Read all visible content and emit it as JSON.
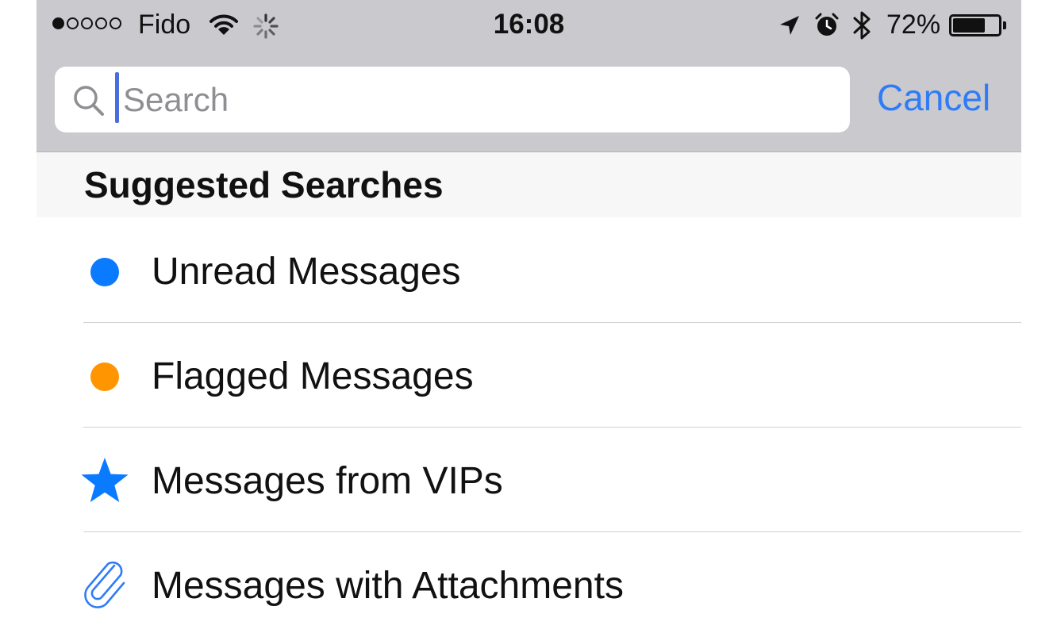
{
  "status_bar": {
    "carrier": "Fido",
    "time": "16:08",
    "battery_percent": "72%",
    "battery_level": 0.72,
    "signal_strength": 1,
    "signal_max": 5,
    "icons": [
      "wifi-icon",
      "activity-spinner-icon",
      "location-arrow-icon",
      "alarm-clock-icon",
      "bluetooth-icon",
      "battery-icon"
    ]
  },
  "search": {
    "placeholder": "Search",
    "value": "",
    "cancel_label": "Cancel",
    "icon": "search-icon"
  },
  "section": {
    "title": "Suggested Searches"
  },
  "suggestions": [
    {
      "label": "Unread Messages",
      "icon": "blue-dot-icon",
      "color": "#0a7aff"
    },
    {
      "label": "Flagged Messages",
      "icon": "orange-dot-icon",
      "color": "#ff9500"
    },
    {
      "label": "Messages from VIPs",
      "icon": "star-icon",
      "color": "#0a7aff"
    },
    {
      "label": "Messages with Attachments",
      "icon": "paperclip-icon",
      "color": "#2f7cf6"
    }
  ],
  "colors": {
    "accent": "#2f7cf6",
    "bar_background": "#c9c9ce",
    "section_background": "#f7f7f7"
  }
}
